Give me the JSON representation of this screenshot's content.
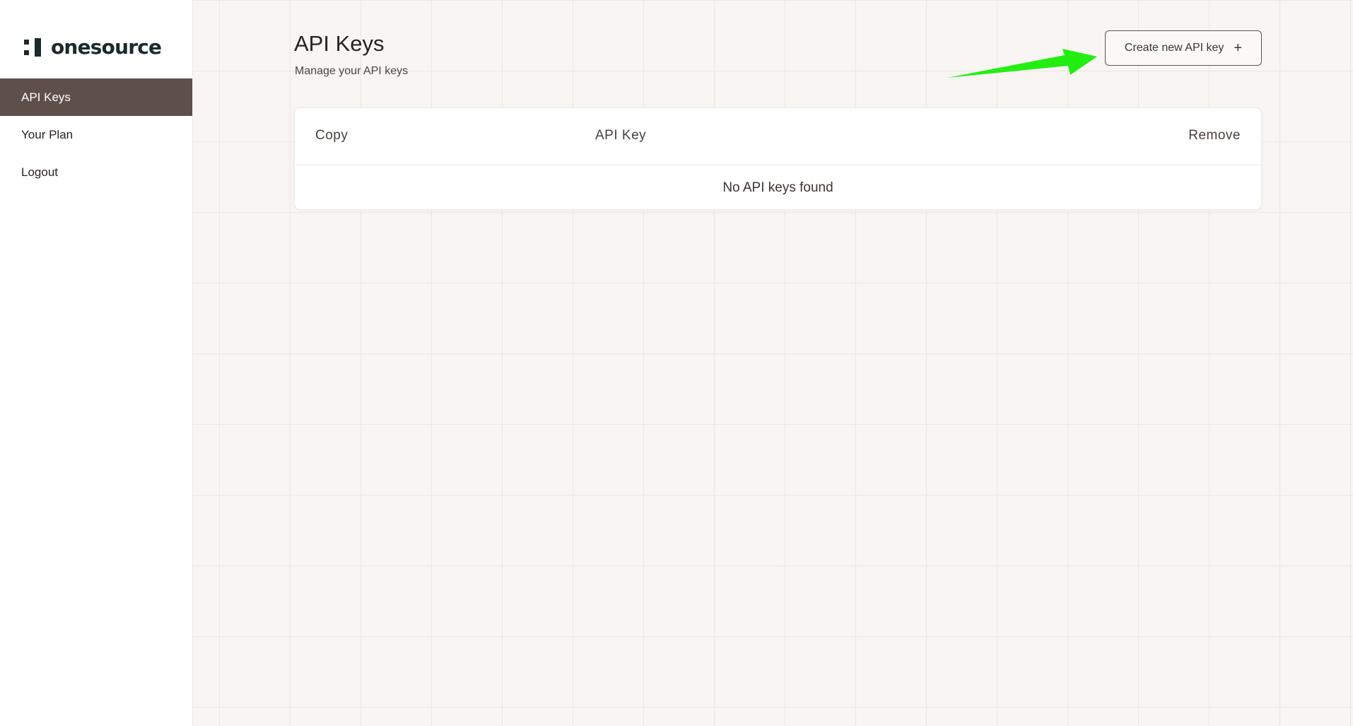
{
  "brand": {
    "name": "onesource",
    "logo_icon": "onesource-logo-mark"
  },
  "sidebar": {
    "items": [
      {
        "label": "API Keys",
        "active": true
      },
      {
        "label": "Your Plan",
        "active": false
      },
      {
        "label": "Logout",
        "active": false
      }
    ]
  },
  "main": {
    "title": "API Keys",
    "subtitle": "Manage your API keys",
    "create_button": {
      "label": "Create new API key",
      "icon": "plus-icon"
    },
    "table": {
      "columns": [
        "Copy",
        "API Key",
        "Remove"
      ],
      "empty_text": "No API keys found"
    }
  },
  "annotation": {
    "type": "arrow",
    "color": "#22ee11",
    "points_to": "create-new-api-key-button"
  },
  "colors": {
    "sidebar_active_bg": "#5e4f4b",
    "main_bg": "#f8f5f2",
    "brand_dark": "#1b2b2b"
  }
}
